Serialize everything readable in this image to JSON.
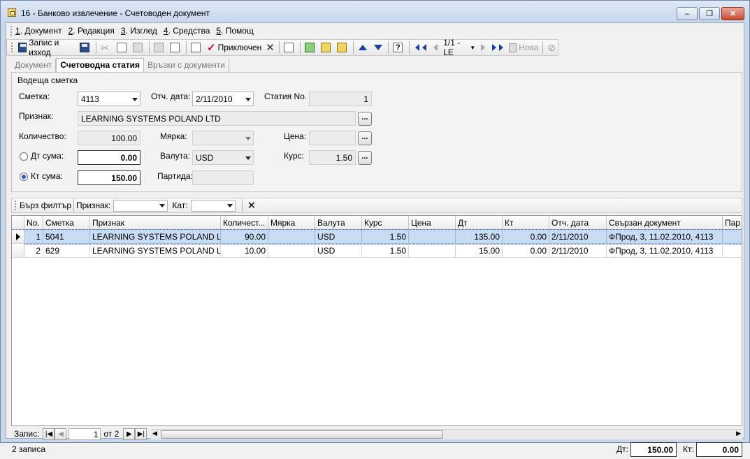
{
  "window": {
    "title": "16 - Банково извлечение - Счетоводен документ",
    "minimize": "‒",
    "restore": "❐",
    "close": "✕"
  },
  "menu": [
    {
      "key": "1",
      "label": ". Документ"
    },
    {
      "key": "2",
      "label": ". Редакция"
    },
    {
      "key": "3",
      "label": ". Изглед"
    },
    {
      "key": "4",
      "label": ". Средства"
    },
    {
      "key": "5",
      "label": ". Помощ"
    }
  ],
  "toolbar": {
    "save_exit": "Запис и изход",
    "finished": "Приключен",
    "record_pos": "1/1 - LE",
    "new_label": "Нова"
  },
  "tabs": [
    {
      "label": "Документ",
      "active": false
    },
    {
      "label": "Счетоводна статия",
      "active": true
    },
    {
      "label": "Връзки с документи",
      "active": false
    }
  ],
  "form": {
    "group_title": "Водеща сметка",
    "account_label": "Сметка:",
    "account_value": "4113",
    "report_date_label": "Отч. дата:",
    "report_date_value": "2/11/2010",
    "entry_no_label": "Статия No.",
    "entry_no_value": "1",
    "sign_label": "Признак:",
    "sign_value": "LEARNING SYSTEMS POLAND LTD",
    "qty_label": "Количество:",
    "qty_value": "100.00",
    "unit_label": "Мярка:",
    "unit_value": "",
    "price_label": "Цена:",
    "price_value": "",
    "debit_label": "Дт сума:",
    "debit_value": "0.00",
    "currency_label": "Валута:",
    "currency_value": "USD",
    "rate_label": "Курс:",
    "rate_value": "1.50",
    "credit_label": "Кт сума:",
    "credit_value": "150.00",
    "batch_label": "Партида:",
    "batch_value": "",
    "ellipsis": "..."
  },
  "filter": {
    "quick_filter": "Бърз филтър",
    "sign_label": "Признак:",
    "kat_label": "Кат:"
  },
  "grid": {
    "columns": [
      "No.",
      "Сметка",
      "Признак",
      "Количест...",
      "Мярка",
      "Валута",
      "Курс",
      "Цена",
      "Дт",
      "Кт",
      "Отч. дата",
      "Свързан документ",
      "Пар"
    ],
    "rows": [
      [
        "1",
        "5041",
        "LEARNING SYSTEMS POLAND LTD",
        "90.00",
        "",
        "USD",
        "1.50",
        "",
        "135.00",
        "0.00",
        "2/11/2010",
        "ФПрод, 3, 11.02.2010, 4113",
        ""
      ],
      [
        "2",
        "629",
        "LEARNING SYSTEMS POLAND LTD",
        "10.00",
        "",
        "USD",
        "1.50",
        "",
        "15.00",
        "0.00",
        "2/11/2010",
        "ФПрод, 3, 11.02.2010, 4113",
        ""
      ]
    ],
    "selected_row": 0
  },
  "nav": {
    "record_label": "Запис:",
    "record_value": "1",
    "of_label": "от 2"
  },
  "status": {
    "count_text": "2 записа",
    "dt_label": "Дт:",
    "dt_value": "150.00",
    "kt_label": "Кт:",
    "kt_value": "0.00"
  }
}
